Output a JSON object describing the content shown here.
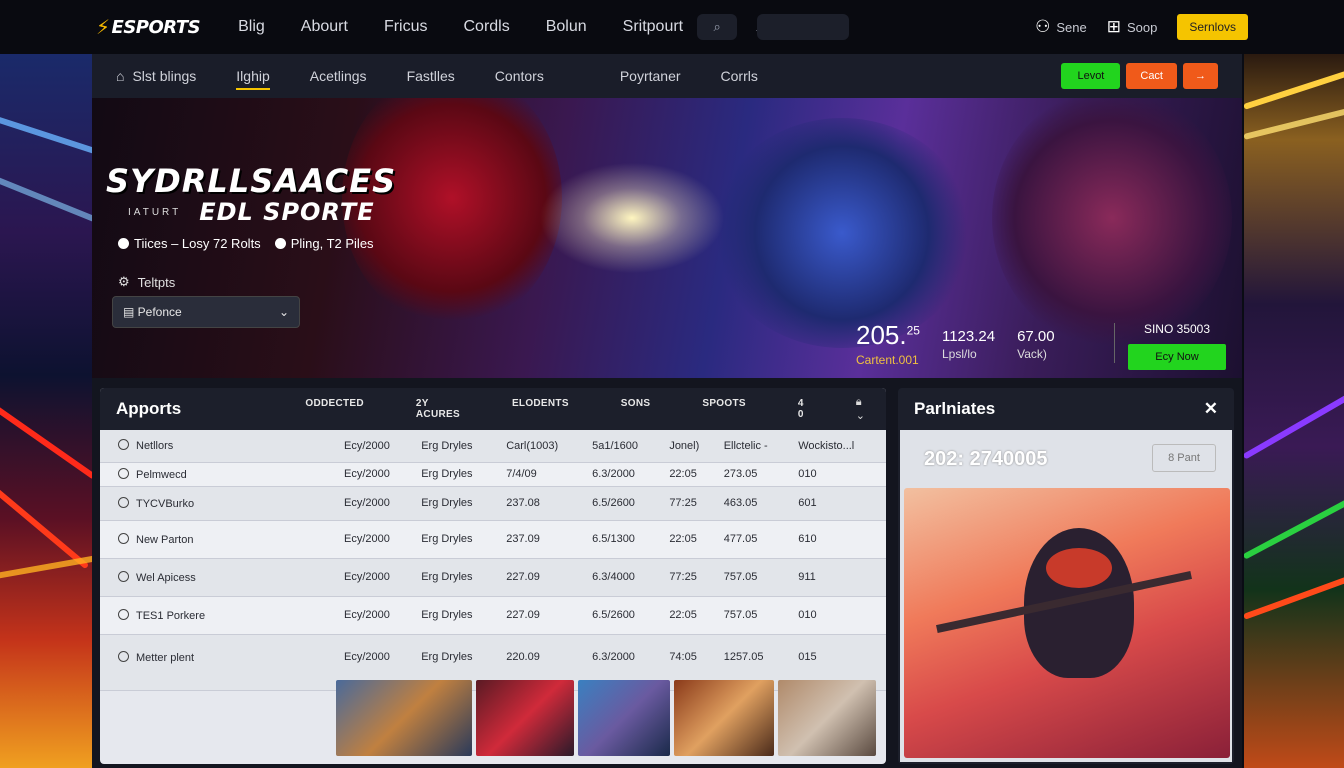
{
  "brand": {
    "logo_text": "ESPORTS",
    "accent": "#f5c400"
  },
  "topnav": {
    "items": [
      "Blig",
      "Abourt",
      "Fricus",
      "Cordls",
      "Bolun",
      "Sritpourt"
    ]
  },
  "search": {
    "placeholder": ""
  },
  "top_right": {
    "user_label": "Sene",
    "shop_label": "Soop",
    "cta_label": "Sernlovs"
  },
  "subnav": {
    "home_label": "Slst blings",
    "tabs": [
      "Ilghip",
      "Acetlings",
      "Fastlles",
      "Contors",
      "Poyrtaner",
      "Corrls"
    ],
    "btn_green": "Levot",
    "btn_orange": "Cact",
    "btn_arrow": "→"
  },
  "hero": {
    "title": "SYDRLLSAACES",
    "sub_small": "IATURT",
    "sub": "EDL SPORTE",
    "meta_1": "Tiices – Losy 72 Rolts",
    "meta_2": "Pling, T2 Piles",
    "tag": "Teltpts",
    "select_value": "Pefonce",
    "stat_1_big": "205.",
    "stat_1_sup": "25",
    "stat_1_lbl": "Cartent.001",
    "stat_2_val": "1123.24",
    "stat_2_lbl": "Lpsl/lo",
    "stat_3_val": "67.00",
    "stat_3_lbl": "Vack)",
    "cta_caption": "SINO 35003",
    "cta_button": "Ecy Now"
  },
  "table": {
    "title": "Apports",
    "columns": [
      "ODDECTED",
      "2Y ACURES",
      "ELODENTS",
      "SONS",
      "SPOOTS",
      "4 0"
    ],
    "rows": [
      {
        "name": "Netllors",
        "c1": "Ecy/2000",
        "c2": "Erg Dryles",
        "c3": "Carl(1003)",
        "c4": "5a1/1600",
        "c5": "Jonel)",
        "c6": "Ellctelic -",
        "c7": "Wockisto...l"
      },
      {
        "name": "Pelmwecd",
        "c1": "Ecy/2000",
        "c2": "Erg Dryles",
        "c3": "7/4/09",
        "c4": "6.3/2000",
        "c5": "22:05",
        "c6": "273.05",
        "c7": "010"
      },
      {
        "name": "TYCVBurko",
        "c1": "Ecy/2000",
        "c2": "Erg Dryles",
        "c3": "237.08",
        "c4": "6.5/2600",
        "c5": "77:25",
        "c6": "463.05",
        "c7": "601"
      },
      {
        "name": "New Parton",
        "c1": "Ecy/2000",
        "c2": "Erg Dryles",
        "c3": "237.09",
        "c4": "6.5/1300",
        "c5": "22:05",
        "c6": "477.05",
        "c7": "610"
      },
      {
        "name": "Wel Apicess",
        "c1": "Ecy/2000",
        "c2": "Erg Dryles",
        "c3": "227.09",
        "c4": "6.3/4000",
        "c5": "77:25",
        "c6": "757.05",
        "c7": "911"
      },
      {
        "name": "TES1 Porkere",
        "c1": "Ecy/2000",
        "c2": "Erg Dryles",
        "c3": "227.09",
        "c4": "6.5/2600",
        "c5": "22:05",
        "c6": "757.05",
        "c7": "010"
      },
      {
        "name": "Metter plent",
        "c1": "Ecy/2000",
        "c2": "Erg Dryles",
        "c3": "220.09",
        "c4": "6.3/2000",
        "c5": "74:05",
        "c6": "1257.05",
        "c7": "015"
      }
    ]
  },
  "right_panel": {
    "title": "Parlniates",
    "value": "202: 2740005",
    "button": "8 Pant"
  },
  "icons": {
    "home": "home-icon",
    "search": "search-icon",
    "user": "user-icon",
    "shop": "shop-icon",
    "close": "close-icon",
    "chevron": "chevron-down-icon",
    "lock": "lock-icon"
  }
}
